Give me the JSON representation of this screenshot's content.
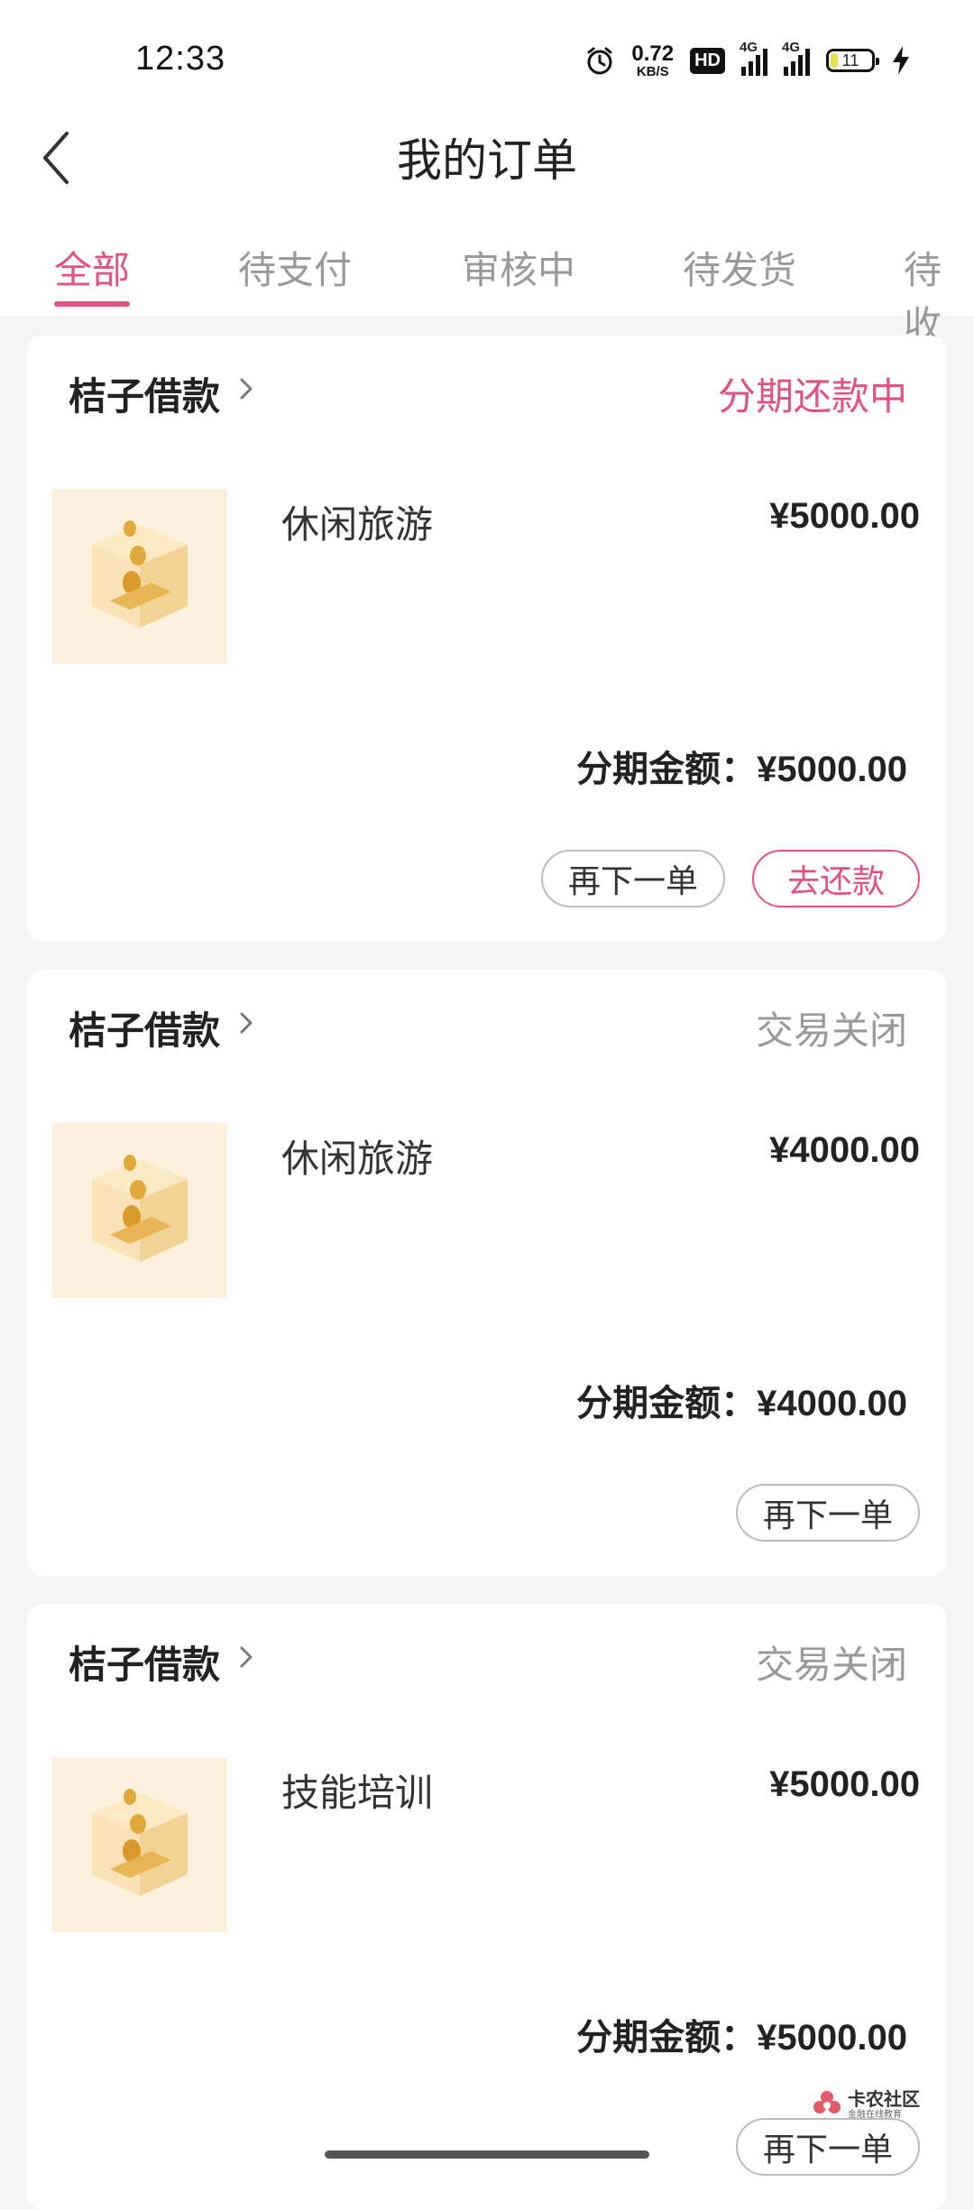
{
  "status_bar": {
    "time": "12:33",
    "net_speed_value": "0.72",
    "net_speed_unit": "KB/S",
    "hd_label": "HD",
    "sim1_label": "4G",
    "sim2_label": "4G",
    "battery": "11"
  },
  "header": {
    "title": "我的订单"
  },
  "tabs": [
    "全部",
    "待支付",
    "审核中",
    "待发货",
    "待收"
  ],
  "orders": [
    {
      "merchant": "桔子借款",
      "status": "分期还款中",
      "status_color": "#e15181",
      "product": "休闲旅游",
      "price": "¥5000.00",
      "installment": "分期金额：¥5000.00",
      "reorder_label": "再下一单",
      "pay_label": "去还款"
    },
    {
      "merchant": "桔子借款",
      "status": "交易关闭",
      "status_color": "#999999",
      "product": "休闲旅游",
      "price": "¥4000.00",
      "installment": "分期金额：¥4000.00",
      "reorder_label": "再下一单"
    },
    {
      "merchant": "桔子借款",
      "status": "交易关闭",
      "status_color": "#999999",
      "product": "技能培训",
      "price": "¥5000.00",
      "installment": "分期金额：¥5000.00",
      "reorder_label": "再下一单"
    }
  ],
  "watermark": {
    "name": "卡农社区",
    "sub": "金融在线教育"
  },
  "colors": {
    "accent": "#e15181",
    "muted": "#999999",
    "page_bg": "#f5f5f5"
  },
  "icons": {
    "back": "chevron-left-icon",
    "merchant_arrow": "chevron-right-icon",
    "product": "coin-box-icon",
    "alarm": "alarm-clock-icon"
  }
}
